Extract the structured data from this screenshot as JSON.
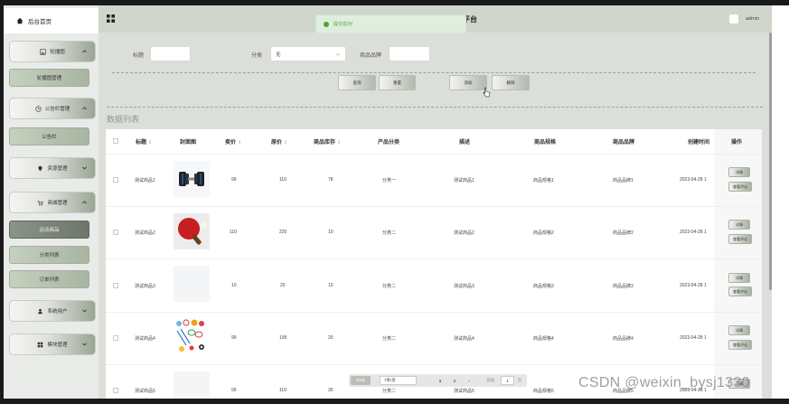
{
  "sidebar": {
    "home": "后台首页",
    "menus": [
      {
        "label": "轮播图",
        "sub": [
          "轮播图管理"
        ]
      },
      {
        "label": "公告栏管理",
        "sub": [
          "公告栏"
        ]
      },
      {
        "label": "资源管理",
        "sub": []
      },
      {
        "label": "商城管理",
        "sub": [
          "运动商品",
          "分类列表",
          "订单列表"
        ]
      },
      {
        "label": "系统用户",
        "sub": []
      },
      {
        "label": "模块管理",
        "sub": []
      }
    ]
  },
  "header": {
    "toast": "提交成功!",
    "title_visible": "平台",
    "user": "admin"
  },
  "search": {
    "title_label": "标题",
    "category_label": "分类",
    "category_value": "无",
    "brand_label": "商品品牌",
    "btn_query": "查询",
    "btn_reset": "重置",
    "btn_add": "添加",
    "btn_delete": "删除"
  },
  "table": {
    "section_title": "数据列表",
    "headers": [
      "标题",
      "封面图",
      "卖价",
      "原价",
      "商品库存",
      "产品分类",
      "描述",
      "商品规格",
      "商品品牌",
      "创建时间",
      "操作"
    ],
    "rows": [
      {
        "title": "测试商品1",
        "image": "dumbbell",
        "sale": "99",
        "orig": "110",
        "stock": "78",
        "cat": "分类一",
        "desc": "测试商品1",
        "spec": "商品规格1",
        "brand": "商品品牌1",
        "time": "2023-04-28 1"
      },
      {
        "title": "测试商品2",
        "image": "pingpong",
        "sale": "110",
        "orig": "220",
        "stock": "10",
        "cat": "分类二",
        "desc": "测试商品2",
        "spec": "商品规格2",
        "brand": "商品品牌2",
        "time": "2023-04-28 1"
      },
      {
        "title": "测试商品3",
        "image": "blank",
        "sale": "10",
        "orig": "20",
        "stock": "10",
        "cat": "分类二",
        "desc": "测试商品3",
        "spec": "商品规格3",
        "brand": "商品品牌3",
        "time": "2023-04-28 1"
      },
      {
        "title": "测试商品4",
        "image": "sports",
        "sale": "99",
        "orig": "199",
        "stock": "20",
        "cat": "分类二",
        "desc": "测试商品4",
        "spec": "商品规格4",
        "brand": "商品品牌4",
        "time": "2023-04-28 1"
      },
      {
        "title": "测试商品5",
        "image": "blank",
        "sale": "99",
        "orig": "110",
        "stock": "30",
        "cat": "分类二",
        "desc": "测试商品5",
        "spec": "商品规格5",
        "brand": "商品品牌5",
        "time": "2023-04-28 1"
      }
    ],
    "op_detail": "详情",
    "op_review": "查看评论"
  },
  "pager": {
    "total": "共8条",
    "size": "7条/页",
    "prev": "‹",
    "pages": [
      "1",
      "2"
    ],
    "next": "›",
    "goto": "前往",
    "goto_value": "1",
    "page_unit": "页"
  },
  "watermark": "CSDN @weixin_bysj1330",
  "colors": {
    "accent": "#8a9a8f",
    "sidebar_active": "#6d7669",
    "toast": "#52a83b"
  }
}
